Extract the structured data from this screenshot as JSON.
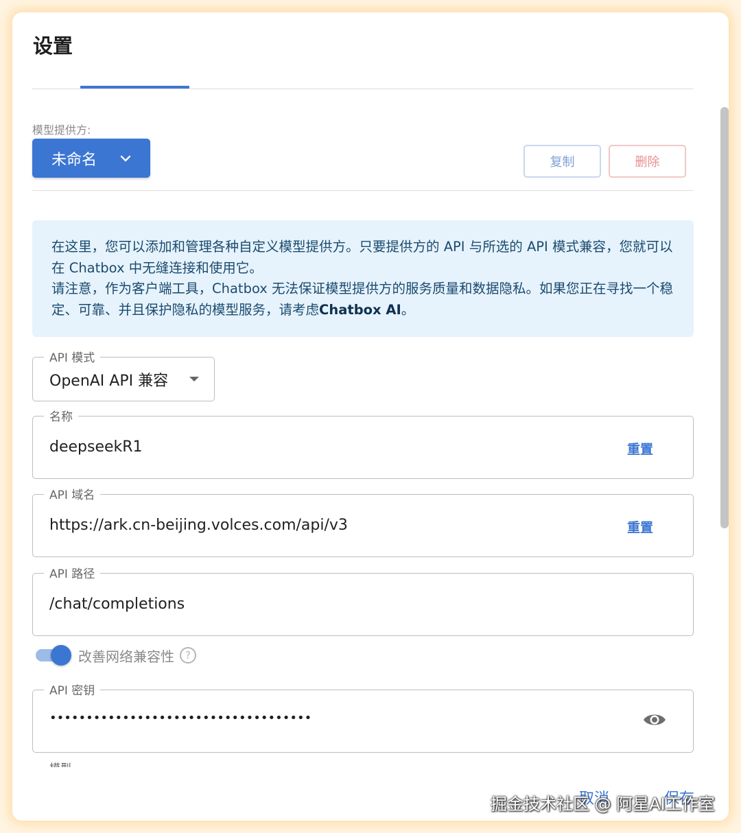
{
  "dialog": {
    "title": "设置"
  },
  "provider": {
    "label": "模型提供方:",
    "selected": "未命名",
    "copy_label": "复制",
    "delete_label": "删除"
  },
  "info": {
    "line1": "在这里，您可以添加和管理各种自定义模型提供方。只要提供方的 API 与所选的 API 模式兼容，您就可以在 Chatbox 中无缝连接和使用它。",
    "line2_prefix": "请注意，作为客户端工具，Chatbox 无法保证模型提供方的服务质量和数据隐私。如果您正在寻找一个稳定、可靠、并且保护隐私的模型服务，请考虑",
    "line2_link": "Chatbox AI",
    "line2_suffix": "。"
  },
  "fields": {
    "api_mode": {
      "label": "API 模式",
      "value": "OpenAI API 兼容"
    },
    "name": {
      "label": "名称",
      "value": "deepseekR1",
      "reset_label": "重置"
    },
    "api_host": {
      "label": "API 域名",
      "value": "https://ark.cn-beijing.volces.com/api/v3",
      "reset_label": "重置"
    },
    "api_path": {
      "label": "API 路径",
      "value": "/chat/completions"
    },
    "api_key": {
      "label": "API 密钥",
      "value": "••••••••••••••••••••••••••••••••••••"
    },
    "model_partial_label": "模型"
  },
  "toggle": {
    "label": "改善网络兼容性",
    "help": "?",
    "on": true
  },
  "footer": {
    "cancel_label": "取消",
    "save_label": "保存"
  },
  "watermark": "掘金技术社区 @ 阿星AI工作室",
  "colors": {
    "accent": "#3c76d3",
    "info_bg": "#e6f3fc",
    "delete": "#e6908f"
  }
}
